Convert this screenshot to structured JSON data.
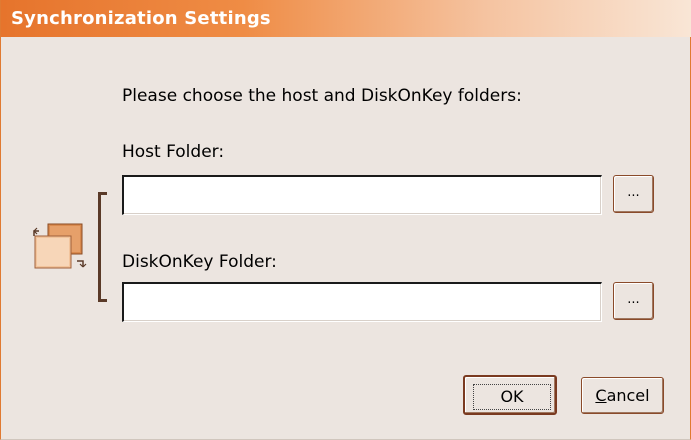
{
  "window": {
    "title": "Synchronization Settings"
  },
  "dialog": {
    "instruction": "Please choose the host and DiskOnKey folders:",
    "host_label": "Host Folder:",
    "host_value": "",
    "dok_label": "DiskOnKey Folder:",
    "dok_value": "",
    "browse_label": "...",
    "ok_label": "OK",
    "cancel_label_first": "C",
    "cancel_label_rest": "ancel"
  },
  "icons": {
    "sync": "sync-folders-icon"
  },
  "colors": {
    "title_bar": "#e6742c",
    "background": "#ece5e0"
  }
}
